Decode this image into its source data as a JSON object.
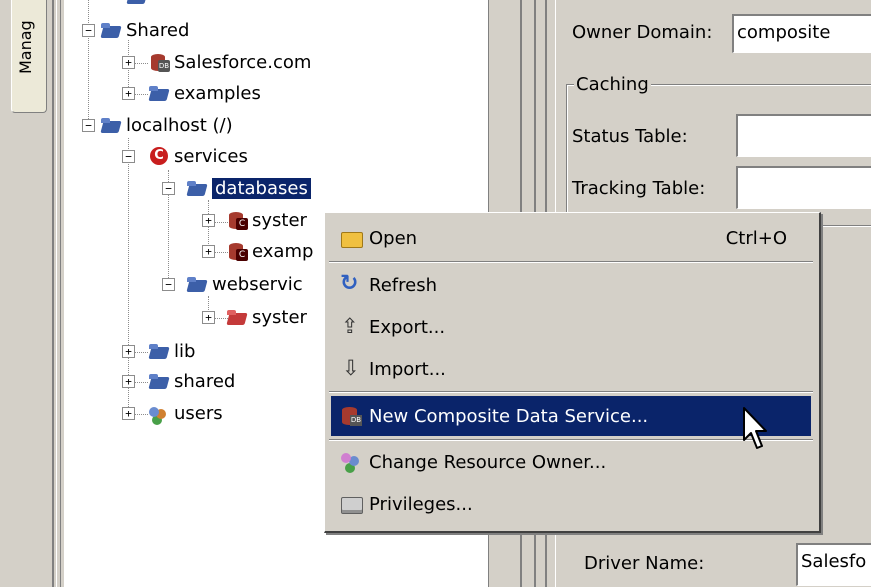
{
  "left_tab": {
    "label": "Manag"
  },
  "tree": {
    "items": [
      {
        "label": "Shared"
      },
      {
        "label": "Salesforce.com"
      },
      {
        "label": "examples"
      },
      {
        "label": "localhost (/)"
      },
      {
        "label": "services"
      },
      {
        "label": "databases"
      },
      {
        "label": "syster"
      },
      {
        "label": "examp"
      },
      {
        "label": "webservic"
      },
      {
        "label": "syster"
      },
      {
        "label": "lib"
      },
      {
        "label": "shared"
      },
      {
        "label": "users"
      }
    ]
  },
  "right_panel": {
    "owner_domain_label": "Owner Domain:",
    "owner_domain_value": "composite",
    "caching_group_label": "Caching",
    "status_table_label": "Status Table:",
    "tracking_table_label": "Tracking Table:",
    "driver_name_label": "Driver Name:",
    "driver_name_value": "Salesfo"
  },
  "context_menu": {
    "items": [
      {
        "label": "Open",
        "shortcut": "Ctrl+O",
        "icon": "open-folder-icon"
      },
      {
        "label": "Refresh",
        "icon": "refresh-icon"
      },
      {
        "label": "Export...",
        "icon": "export-icon"
      },
      {
        "label": "Import...",
        "icon": "import-icon"
      },
      {
        "label": "New Composite Data Service...",
        "icon": "new-data-service-icon"
      },
      {
        "label": "Change Resource Owner...",
        "icon": "change-owner-icon"
      },
      {
        "label": "Privileges...",
        "icon": "privileges-icon"
      }
    ],
    "highlighted_item": "New Composite Data Service..."
  },
  "colors": {
    "selection": "#0a246a",
    "window_bg": "#d4d0c8"
  }
}
